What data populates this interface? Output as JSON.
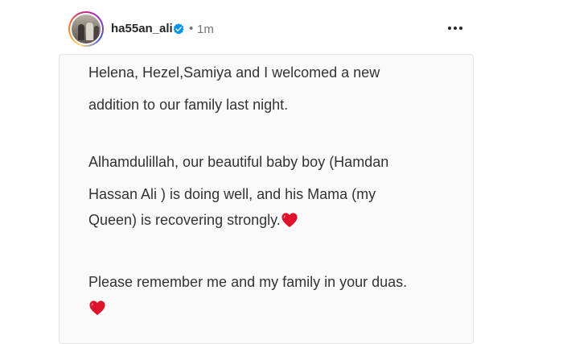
{
  "post": {
    "username": "ha55an_ali",
    "separator": "•",
    "time": "1m",
    "verified_icon": "verified-badge-icon",
    "more_icon": "more-options-icon",
    "ring_colors": [
      "#feda75",
      "#fa7e1e",
      "#d62976",
      "#962fbf",
      "#4f5bd5"
    ]
  },
  "note": {
    "line1": "Helena, Hezel,Samiya and I welcomed a new",
    "line2": "addition to our family last night.",
    "line3": "Alhamdulillah, our beautiful baby boy (Hamdan",
    "line4": "Hassan Ali ) is doing well, and his Mama (my",
    "line5": "Queen) is recovering strongly.",
    "line6": "Please remember me and my family in your duas.",
    "heart_icon": "red-heart-emoji",
    "heart_color": "#e0112b"
  }
}
